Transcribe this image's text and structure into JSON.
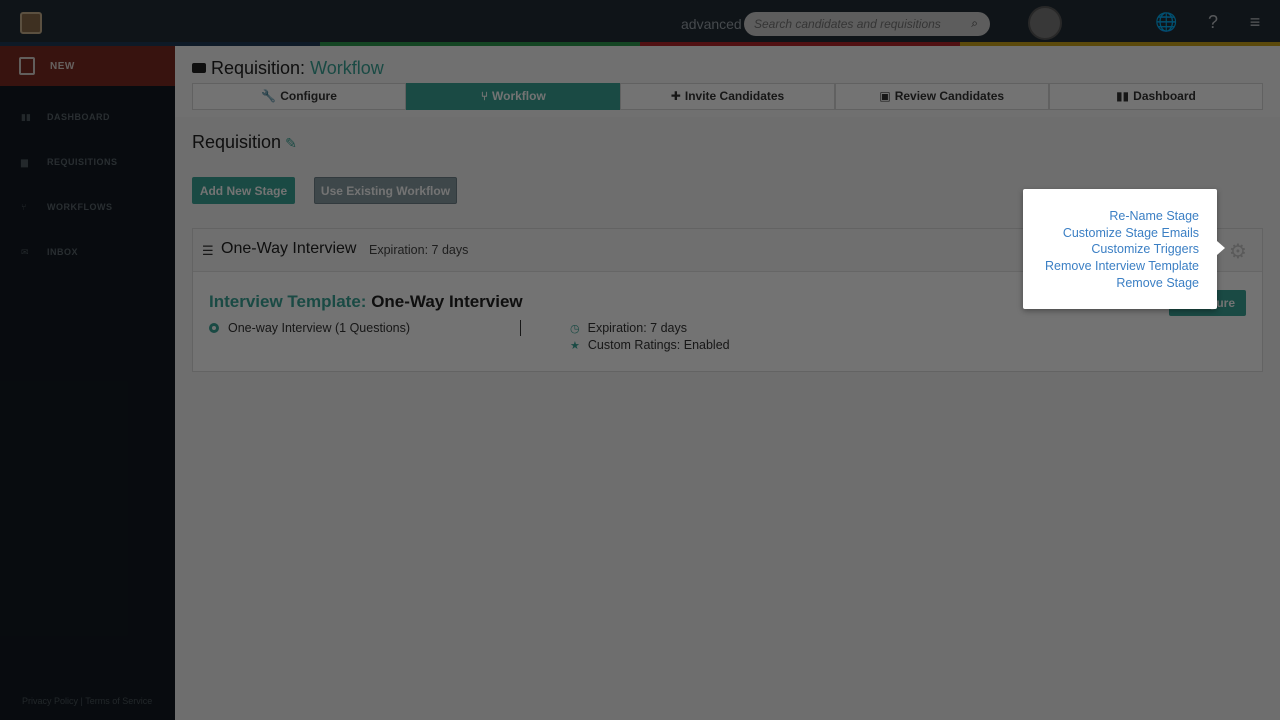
{
  "topbar": {
    "mode_label": "advanced",
    "search_placeholder": "Search candidates and requisitions",
    "progress_colors": [
      "#1f3a57",
      "#2e9a4e",
      "#b3262a",
      "#c9a21a"
    ]
  },
  "sidebar": {
    "new_label": "NEW",
    "items": [
      {
        "label": "DASHBOARD",
        "icon": "bar-chart-icon"
      },
      {
        "label": "REQUISITIONS",
        "icon": "document-icon"
      },
      {
        "label": "WORKFLOWS",
        "icon": "branch-icon"
      },
      {
        "label": "INBOX",
        "icon": "envelope-icon"
      }
    ],
    "footer": "Privacy Policy | Terms of Service"
  },
  "page": {
    "title_prefix": "Requisition:",
    "title_accent": "Workflow",
    "steps": [
      {
        "label": "Configure",
        "glyph": "🔧"
      },
      {
        "label": "Workflow",
        "glyph": "⑂"
      },
      {
        "label": "Invite Candidates",
        "glyph": "✚"
      },
      {
        "label": "Review Candidates",
        "glyph": "▣"
      },
      {
        "label": "Dashboard",
        "glyph": "▮▮"
      }
    ],
    "section_title": "Requisition",
    "add_stage_label": "Add New Stage",
    "use_workflow_label": "Use Existing Workflow"
  },
  "stage": {
    "name": "One-Way Interview",
    "expiration": "Expiration: 7 days",
    "template_label": "Interview Template:",
    "template_name": "One-Way Interview",
    "questions": "One-way Interview (1 Questions)",
    "detail_expiration": "Expiration: 7 days",
    "detail_ratings": "Custom Ratings: Enabled",
    "configure_label": "Configure"
  },
  "popover": {
    "items": [
      "Re-Name Stage",
      "Customize Stage Emails",
      "Customize Triggers",
      "Remove Interview Template",
      "Remove Stage"
    ]
  }
}
